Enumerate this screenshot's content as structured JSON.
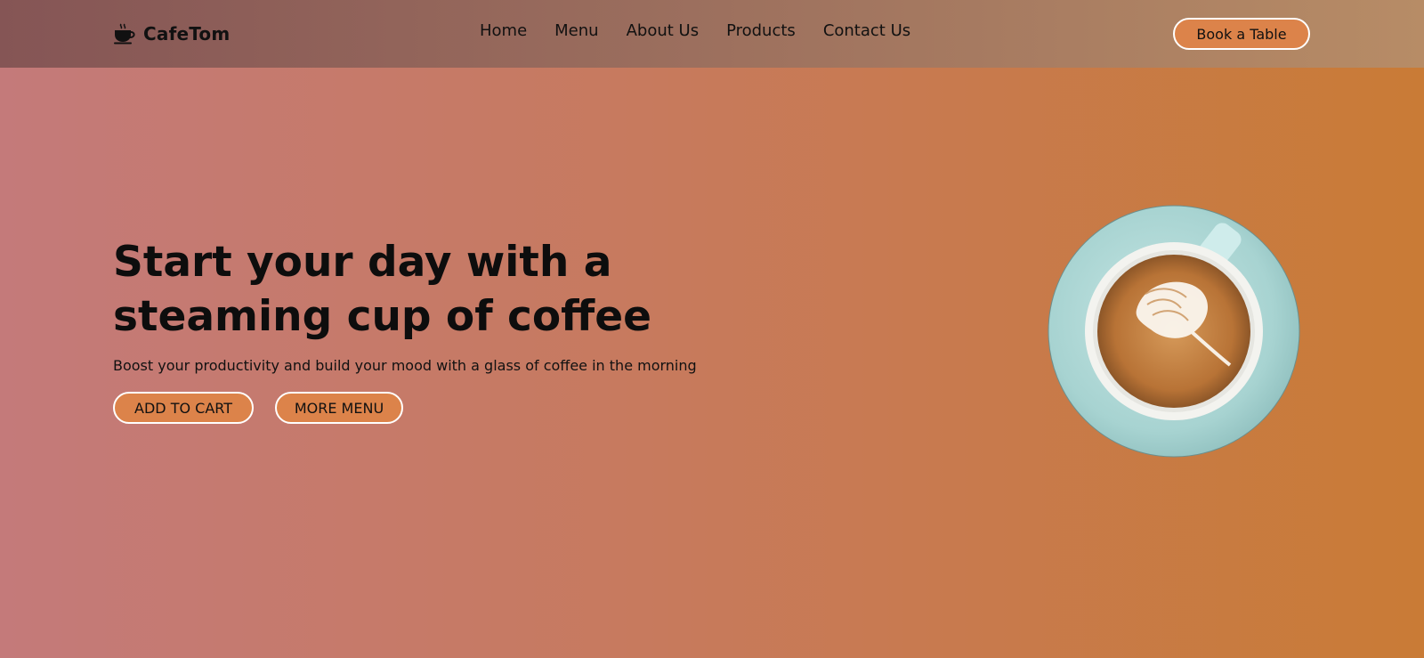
{
  "brand": {
    "name": "CafeTom",
    "icon": "coffee-cup-icon"
  },
  "nav": {
    "items": [
      {
        "label": "Home"
      },
      {
        "label": "Menu"
      },
      {
        "label": "About Us"
      },
      {
        "label": "Products"
      },
      {
        "label": "Contact Us"
      }
    ],
    "cta_label": "Book a Table"
  },
  "hero": {
    "title_line1": "Start your day with a",
    "title_line2": "steaming cup of coffee",
    "subtitle": "Boost your productivity and build your mood with a glass of coffee in the morning",
    "buttons": {
      "add_to_cart": "ADD TO CART",
      "more_menu": "MORE MENU"
    },
    "image": "latte-art-coffee-cup"
  },
  "colors": {
    "accent_button": "#dc834a",
    "button_border": "#ffffff",
    "bg_left": "#c47a7a",
    "bg_right": "#c97b36"
  }
}
